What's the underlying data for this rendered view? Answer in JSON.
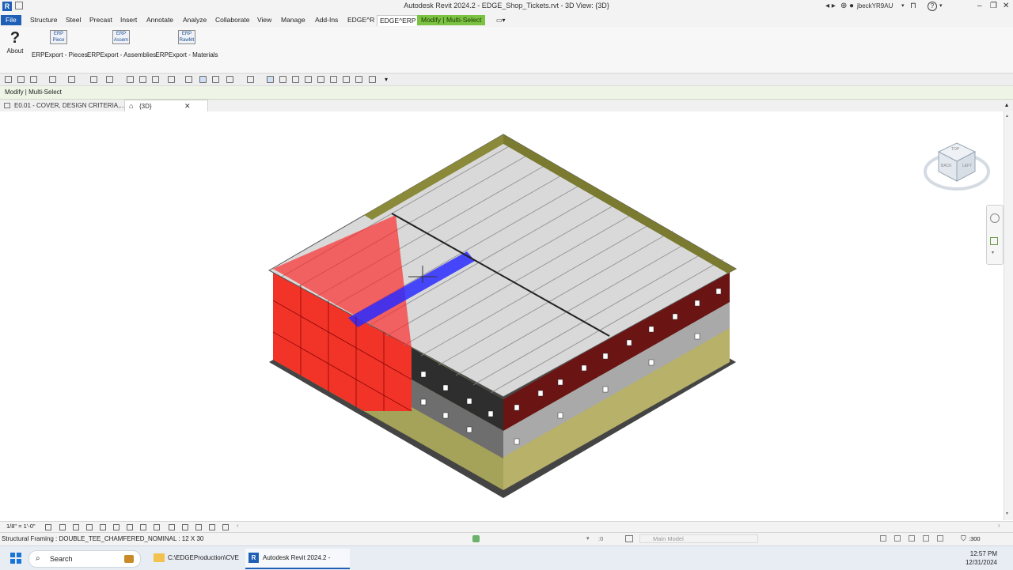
{
  "window": {
    "title": "Autodesk Revit 2024.2 - EDGE_Shop_Tickets.rvt - 3D View: {3D}",
    "username": "jbeckYR9AU",
    "help_glyph": "?"
  },
  "ribbon_tabs": [
    {
      "label": "File"
    },
    {
      "label": "Structure"
    },
    {
      "label": "Steel"
    },
    {
      "label": "Precast"
    },
    {
      "label": "Insert"
    },
    {
      "label": "Annotate"
    },
    {
      "label": "Analyze"
    },
    {
      "label": "Collaborate"
    },
    {
      "label": "View"
    },
    {
      "label": "Manage"
    },
    {
      "label": "Add-Ins"
    },
    {
      "label": "EDGE^R"
    },
    {
      "label": "EDGE^ERP"
    },
    {
      "label": "Modify | Multi-Select"
    }
  ],
  "ribbon": {
    "about_glyph": "?",
    "about_label": "About",
    "buttons": [
      {
        "icon_text": "ERP",
        "sub": "Piece",
        "label": "ERPExport - Pieces"
      },
      {
        "icon_text": "ERP",
        "sub": "Assem",
        "label": "ERPExport - Assemblies"
      },
      {
        "icon_text": "ERP",
        "sub": "RawMt",
        "label": "ERPExport - Materials"
      }
    ]
  },
  "context_bar": {
    "label": "Modify | Multi-Select"
  },
  "view_tabs": [
    {
      "label": "E0.01 - COVER, DESIGN CRITERIA,..."
    },
    {
      "label": "{3D}"
    }
  ],
  "viewcube": {
    "top": "TOP",
    "back": "BACK",
    "left": "LEFT"
  },
  "view_control": {
    "scale": "1/8\" = 1'-0\""
  },
  "status": {
    "selection": "Structural Framing : DOUBLE_TEE_CHAMFERED_NOMINAL : 12 X 30",
    "workset_count": ":0",
    "model": "Main Model",
    "filter_count": ":300"
  },
  "taskbar": {
    "search_placeholder": "Search",
    "items": [
      {
        "label": "C:\\EDGEProduction\\CVE"
      },
      {
        "label": "Autodesk Revit 2024.2 -"
      }
    ],
    "time": "12:57 PM",
    "date": "12/31/2024"
  },
  "colors": {
    "selection_red": "#ff2020",
    "selection_blue": "#2a2aff",
    "wall_olive": "#8a8a3a",
    "wall_dark_red": "#6a1414",
    "context_green": "#7cc242",
    "file_tab_blue": "#1f5fb5"
  }
}
